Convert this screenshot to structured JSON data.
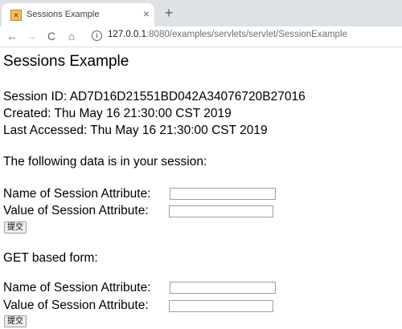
{
  "browser": {
    "tab_title": "Sessions Example",
    "tab_close": "×",
    "new_tab": "+",
    "back": "←",
    "forward": "→",
    "reload": "C",
    "home": "⌂",
    "url_host": "127.0.0.1",
    "url_rest": ":8080/examples/servlets/servlet/SessionExample"
  },
  "page": {
    "title": "Sessions Example",
    "session_id": "Session ID: AD7D16D21551BD042A34076720B27016",
    "created": "Created: Thu May 16 21:30:00 CST 2019",
    "last_accessed": "Last Accessed: Thu May 16 21:30:00 CST 2019",
    "data_heading": "The following data is in your session:",
    "post_form": {
      "name_label": "Name of Session Attribute:",
      "value_label": "Value of Session Attribute:",
      "name_value": "",
      "value_value": "",
      "submit_label": "提交"
    },
    "get_heading": "GET based form:",
    "get_form": {
      "name_label": "Name of Session Attribute:",
      "value_label": "Value of Session Attribute:",
      "name_value": "",
      "value_value": "",
      "submit_label": "提交"
    }
  },
  "colors": {
    "tabstrip": "#dee1e6",
    "url_host": "#202124",
    "url_path": "#6b6f73"
  }
}
